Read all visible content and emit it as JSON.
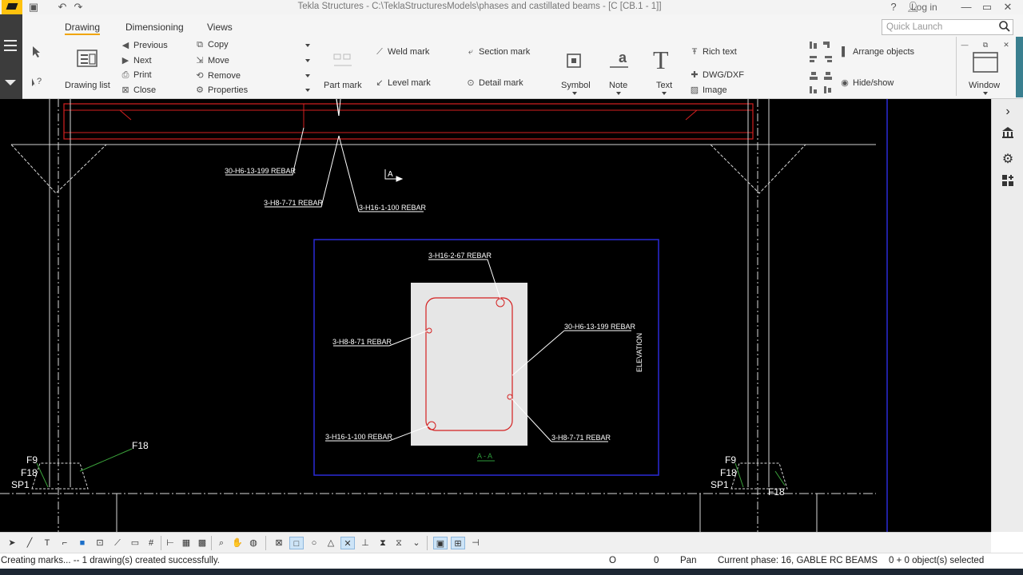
{
  "window": {
    "title": "Tekla Structures - C:\\TeklaStructuresModels\\phases and castillated beams - [C   [CB.1 - 1]]",
    "login": "Log in",
    "help": "?"
  },
  "ribbon": {
    "tabs": [
      "Drawing",
      "Dimensioning",
      "Views"
    ],
    "quick_launch_placeholder": "Quick Launch",
    "drawing_list": "Drawing list",
    "nav": {
      "previous": "Previous",
      "next": "Next",
      "print": "Print",
      "close": "Close"
    },
    "edit": {
      "copy": "Copy",
      "move": "Move",
      "remove": "Remove",
      "properties": "Properties"
    },
    "part_mark": "Part mark",
    "weld_mark": "Weld mark",
    "level_mark": "Level mark",
    "section_mark": "Section mark",
    "detail_mark": "Detail mark",
    "symbol": "Symbol",
    "note": "Note",
    "text": "Text",
    "rich_text": "Rich text",
    "dwg_dxf": "DWG/DXF",
    "image": "Image",
    "arrange_objects": "Arrange objects",
    "hide_show": "Hide/show",
    "window": "Window"
  },
  "drawing": {
    "labels": {
      "rebar_30h6": "30-H6-13-199 REBAR",
      "rebar_3h8_71": "3-H8-7-71 REBAR",
      "rebar_3h16_100": "3-H16-1-100 REBAR",
      "section_a": "A",
      "sec_rebar_3h16_2_67": "3-H16-2-67 REBAR",
      "sec_rebar_3h8_8_71": "3-H8-8-71  REBAR",
      "sec_rebar_30h6": "30-H6-13-199 REBAR",
      "sec_rebar_3h16_1_100": "3-H16-1-100 REBAR",
      "sec_rebar_3h8_7_71": "3-H8-7-71 REBAR",
      "elevation": "ELEVATION",
      "section_title": "A - A",
      "left_f9": "F9",
      "left_f18": "F18",
      "left_f18_top": "F18",
      "left_sp1": "SP1",
      "right_f9": "F9",
      "right_f18": "F18",
      "right_sp1": "SP1",
      "right_f18_low": "F18"
    },
    "colors": {
      "background": "#000000",
      "rebar": "#d42020",
      "concrete": "#e6e6e6",
      "frame": "#2a2ad8",
      "leader": "#ffffff",
      "title_green": "#2e9a3a"
    }
  },
  "status": {
    "message": "Creating marks... -- 1 drawing(s) created successfully.",
    "x": "O",
    "y": "0",
    "mode": "Pan",
    "phase": "Current phase: 16, GABLE RC BEAMS",
    "selection": "0 + 0 object(s) selected"
  }
}
